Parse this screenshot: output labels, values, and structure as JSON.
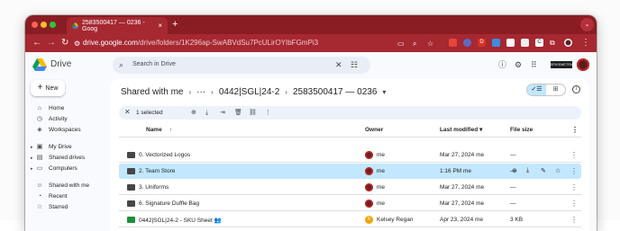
{
  "browser": {
    "tab_title": "2583500417 — 0236 - Goog",
    "tab_close": "×",
    "new_tab": "+",
    "url_host": "drive.google.com",
    "url_path": "/drive/folders/1K296ap-SwABVdSu7PcULirOYIbFGmPi3",
    "ext_c": "C"
  },
  "drive": {
    "product_name": "Drive",
    "search_placeholder": "Search in Drive",
    "brand_badge": "SPIKEMETRICS"
  },
  "sidebar": {
    "new_label": "New",
    "items": [
      {
        "label": "Home",
        "icon": "home-icon"
      },
      {
        "label": "Activity",
        "icon": "activity-icon"
      },
      {
        "label": "Workspaces",
        "icon": "workspaces-icon"
      },
      {
        "label": "My Drive",
        "icon": "my-drive-icon"
      },
      {
        "label": "Shared drives",
        "icon": "shared-drives-icon"
      },
      {
        "label": "Computers",
        "icon": "computers-icon"
      },
      {
        "label": "Shared with me",
        "icon": "shared-with-me-icon"
      },
      {
        "label": "Recent",
        "icon": "recent-icon"
      },
      {
        "label": "Starred",
        "icon": "starred-icon"
      }
    ]
  },
  "breadcrumb": {
    "root": "Shared with me",
    "ellipsis": "···",
    "middle": "0442|SGL|24-2",
    "current": "2583500417 — 0236"
  },
  "selection": {
    "count_text": "1 selected"
  },
  "columns": {
    "name": "Name",
    "owner": "Owner",
    "modified": "Last modified",
    "size": "File size"
  },
  "rows": [
    {
      "name": "0. Vectorized Logos",
      "owner": "me",
      "modified": "Mar 27, 2024 me",
      "size": "—",
      "type": "folder",
      "selected": false
    },
    {
      "name": "2. Team Store",
      "owner": "me",
      "modified": "1:16 PM me",
      "size": "—",
      "type": "folder",
      "selected": true
    },
    {
      "name": "3. Uniforms",
      "owner": "me",
      "modified": "Mar 27, 2024 me",
      "size": "—",
      "type": "folder",
      "selected": false
    },
    {
      "name": "6. Signature Duffle Bag",
      "owner": "me",
      "modified": "Mar 27, 2024 me",
      "size": "—",
      "type": "folder",
      "selected": false
    },
    {
      "name": "0442|SGL|24-2 - SKU Sheet",
      "owner": "Kelsey Regan",
      "owner_initial": "K",
      "modified": "Apr 23, 2024 me",
      "size": "3 KB",
      "type": "sheet",
      "selected": false
    }
  ],
  "colors": {
    "chrome_frame": "#8a1d24",
    "chrome_toolbar": "#a62831",
    "selected_row": "#c2e7ff",
    "selection_bar": "#edf2fa"
  }
}
